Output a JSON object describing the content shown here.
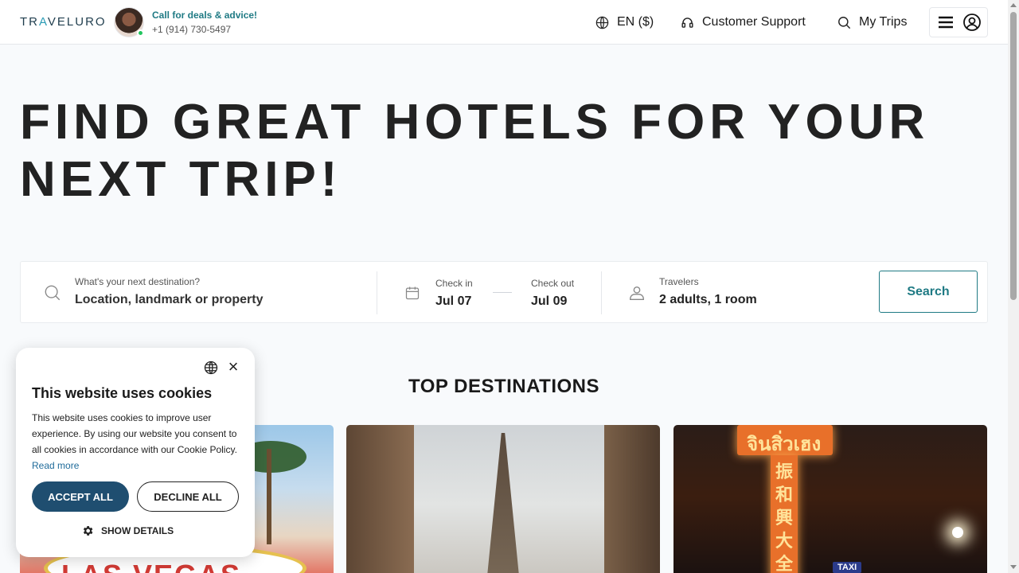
{
  "header": {
    "logo_prefix": "TR",
    "logo_accent": "A",
    "logo_suffix": "VELURO",
    "call_title": "Call for deals & advice!",
    "call_phone": "+1 (914) 730-5497",
    "language": "EN ($)",
    "support": "Customer Support",
    "trips": "My Trips",
    "icons": [
      "globe-icon",
      "headset-icon",
      "search-icon",
      "hamburger-icon",
      "account-icon"
    ]
  },
  "hero": {
    "title": "FIND GREAT HOTELS FOR YOUR NEXT TRIP!"
  },
  "search": {
    "destination_label": "What's your next destination?",
    "destination_placeholder": "Location, landmark or property",
    "checkin_label": "Check in",
    "checkin_value": "Jul 07",
    "checkout_label": "Check out",
    "checkout_value": "Jul 09",
    "travelers_label": "Travelers",
    "travelers_value": "2 adults, 1 room",
    "button": "Search"
  },
  "destinations": {
    "title": "TOP DESTINATIONS",
    "cards": [
      {
        "sign_text": "LAS VEGAS"
      },
      {
        "sign_text": ""
      },
      {
        "sign_text": "TAXI",
        "neon_text": "จินสิ่วเฮง",
        "neon_column": "振和興大全"
      }
    ]
  },
  "cookie": {
    "title": "This website uses cookies",
    "body": "This website uses cookies to improve user experience. By using our website you consent to all cookies in accordance with our Cookie Policy.",
    "read_more": "Read more",
    "accept": "ACCEPT ALL",
    "decline": "DECLINE ALL",
    "details": "SHOW DETAILS",
    "close": "×"
  },
  "colors": {
    "brand": "#1f7a84",
    "accept_button": "#1f4e70",
    "online_dot": "#22c55e"
  }
}
